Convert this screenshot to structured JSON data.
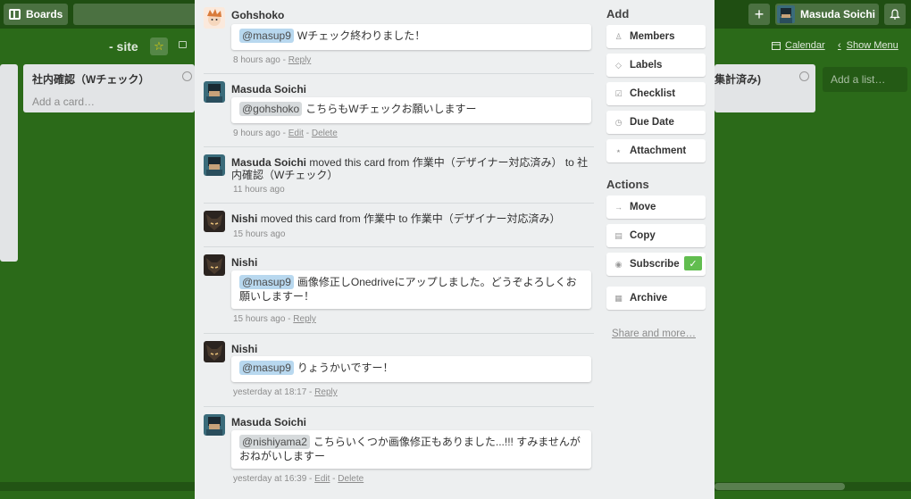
{
  "header": {
    "boards_label": "Boards",
    "search_value": "",
    "user_name": "Masuda Soichi"
  },
  "board": {
    "title": "- site",
    "calendar_label": "Calendar",
    "show_menu_label": "Show Menu"
  },
  "lists": {
    "naibu_title": "社内確認（Wチェック）",
    "add_card": "Add a card…",
    "right_title": "集計済み)",
    "add_list": "Add a list…"
  },
  "activity": [
    {
      "author": "Gohshoko",
      "mention": "@masup9",
      "text": "Wチェック終わりました！",
      "time": "8 hours ago",
      "links": [
        "Reply"
      ]
    },
    {
      "author": "Masuda Soichi",
      "mention": "@gohshoko",
      "text": "こちらもWチェックお願いしますー",
      "time": "9 hours ago",
      "links": [
        "Edit",
        "Delete"
      ]
    },
    {
      "author": "Masuda Soichi",
      "action_text": "moved this card from 作業中（デザイナー対応済み） to 社内確認（Wチェック）",
      "time": "11 hours ago"
    },
    {
      "author": "Nishi",
      "action_text": "moved this card from 作業中 to 作業中（デザイナー対応済み）",
      "time": "15 hours ago"
    },
    {
      "author": "Nishi",
      "mention": "@masup9",
      "text": "画像修正しOnedriveにアップしました。どうぞよろしくお願いしますー！",
      "time": "15 hours ago",
      "links": [
        "Reply"
      ]
    },
    {
      "author": "Nishi",
      "mention": "@masup9",
      "text": "りょうかいですー！",
      "time": "yesterday at 18:17",
      "links": [
        "Reply"
      ]
    },
    {
      "author": "Masuda Soichi",
      "mention": "@nishiyama2",
      "text": "こちらいくつか画像修正もありました...!!! すみませんがおねがいしますー",
      "time": "yesterday at 16:39",
      "links": [
        "Edit",
        "Delete"
      ]
    }
  ],
  "sidebar": {
    "add_heading": "Add",
    "add_buttons": [
      "Members",
      "Labels",
      "Checklist",
      "Due Date",
      "Attachment"
    ],
    "actions_heading": "Actions",
    "action_buttons": [
      "Move",
      "Copy",
      "Subscribe",
      "Archive"
    ],
    "share_label": "Share and more…"
  },
  "colors": {
    "board_bg": "#2b6a19",
    "header_bg": "#1f4e12",
    "subscribe_check": "#61bd4f",
    "mention_self": "#b8d8ef"
  }
}
